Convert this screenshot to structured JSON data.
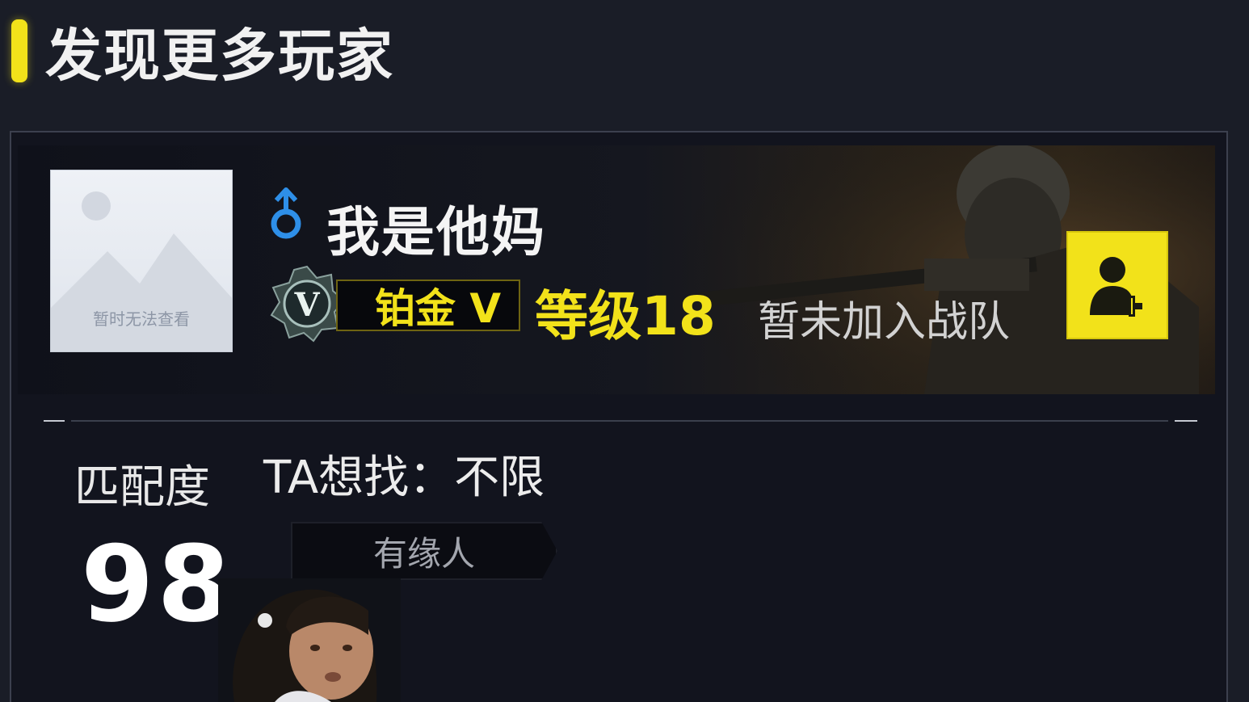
{
  "header": {
    "title": "发现更多玩家"
  },
  "profile": {
    "avatar_placeholder_text": "暂时无法查看",
    "gender_symbol": "♂",
    "name": "我是他妈",
    "rank": {
      "badge_letter": "V",
      "label": "铂金 V"
    },
    "level_label": "等级18",
    "team_status": "暂未加入战队"
  },
  "match": {
    "label": "匹配度",
    "score": "98",
    "seeking_label": "TA想找：",
    "seeking_value": "不限",
    "tag": "有缘人"
  },
  "colors": {
    "accent_yellow": "#f2e21a",
    "gender_blue": "#2e8fe8",
    "background": "#1a1d27",
    "card": "#12141e"
  },
  "icons": [
    "male-gender-icon",
    "rank-badge-icon",
    "add-friend-icon",
    "avatar-placeholder-icon"
  ]
}
